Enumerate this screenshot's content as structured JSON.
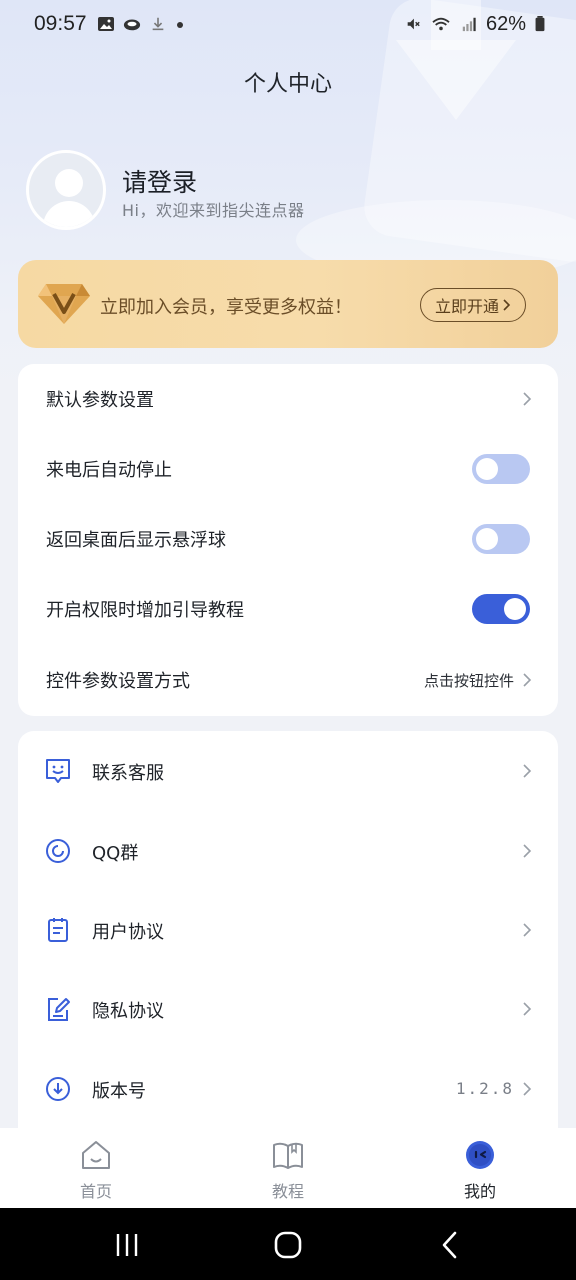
{
  "status_bar": {
    "time": "09:57",
    "battery": "62%"
  },
  "header": {
    "title": "个人中心"
  },
  "profile": {
    "name": "请登录",
    "subtitle": "Hi，欢迎来到指尖连点器"
  },
  "vip": {
    "text": "立即加入会员，享受更多权益！",
    "button": "立即开通"
  },
  "settings": [
    {
      "label": "默认参数设置",
      "type": "link"
    },
    {
      "label": "来电后自动停止",
      "type": "toggle",
      "on": false
    },
    {
      "label": "返回桌面后显示悬浮球",
      "type": "toggle",
      "on": false
    },
    {
      "label": "开启权限时增加引导教程",
      "type": "toggle",
      "on": true
    },
    {
      "label": "控件参数设置方式",
      "type": "link",
      "value": "点击按钮控件"
    }
  ],
  "menu": [
    {
      "label": "联系客服",
      "icon": "customer-service-icon"
    },
    {
      "label": "QQ群",
      "icon": "qq-group-icon"
    },
    {
      "label": "用户协议",
      "icon": "user-agreement-icon"
    },
    {
      "label": "隐私协议",
      "icon": "privacy-agreement-icon"
    },
    {
      "label": "版本号",
      "icon": "version-icon",
      "value": "1.2.8"
    }
  ],
  "tabs": [
    {
      "label": "首页",
      "icon": "home-icon",
      "active": false
    },
    {
      "label": "教程",
      "icon": "book-icon",
      "active": false
    },
    {
      "label": "我的",
      "icon": "mine-icon",
      "active": true
    }
  ],
  "colors": {
    "accent": "#3a5fd9",
    "toggle_off": "#b9c8f2",
    "vip_gold": "#f6d9a3",
    "vip_text": "#6b4e28"
  }
}
